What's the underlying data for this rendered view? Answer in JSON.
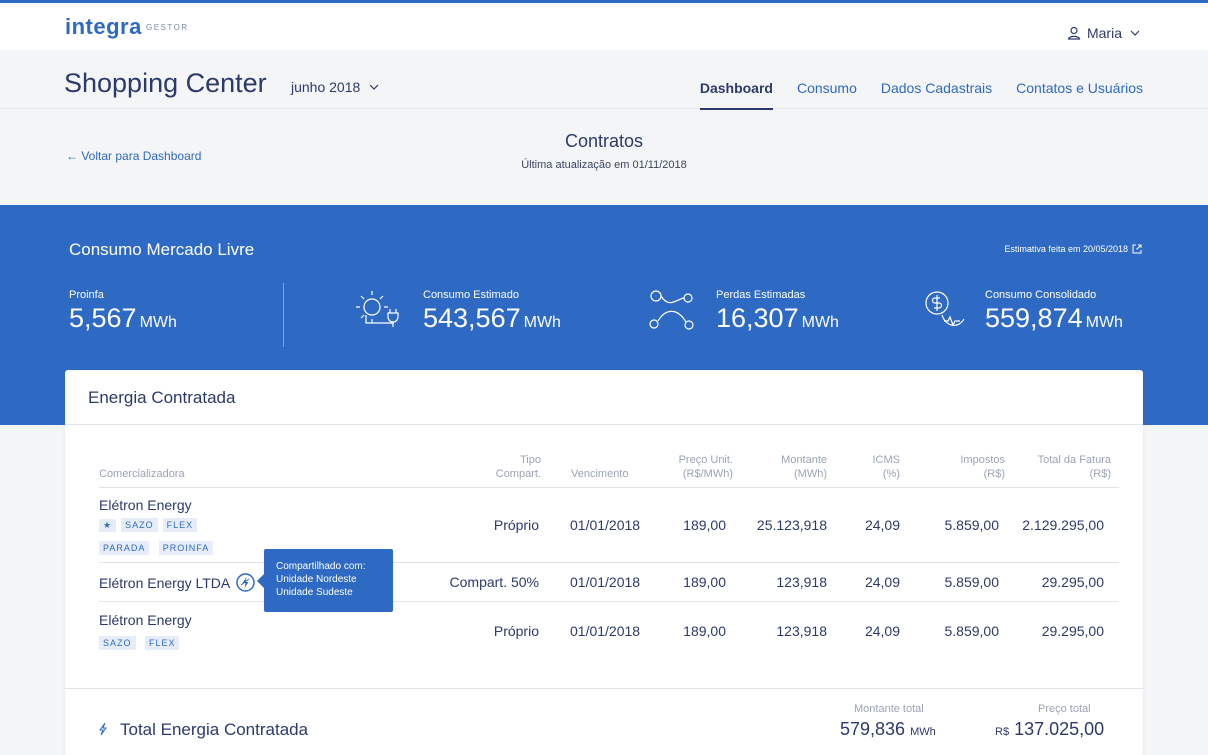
{
  "header": {
    "logo": "integra",
    "logo_sub": "GESTOR",
    "user_name": "Maria"
  },
  "subheader": {
    "title": "Shopping Center",
    "period": "junho 2018",
    "tabs": [
      {
        "label": "Dashboard",
        "active": true
      },
      {
        "label": "Consumo",
        "active": false
      },
      {
        "label": "Dados Cadastrais",
        "active": false
      },
      {
        "label": "Contatos e Usuários",
        "active": false
      }
    ]
  },
  "page": {
    "back_link": "← Voltar para Dashboard",
    "title": "Contratos",
    "updated": "Última atualização em 01/11/2018"
  },
  "mercado": {
    "title": "Consumo Mercado Livre",
    "note": "Estimativa feita em 20/05/2018",
    "metrics": [
      {
        "label": "Proinfa",
        "value": "5,567",
        "unit": "MWh",
        "icon": "none"
      },
      {
        "label": "Consumo Estimado",
        "value": "543,567",
        "unit": "MWh",
        "icon": "sun-plug-icon"
      },
      {
        "label": "Perdas Estimadas",
        "value": "16,307",
        "unit": "MWh",
        "icon": "network-icon"
      },
      {
        "label": "Consumo Consolidado",
        "value": "559,874",
        "unit": "MWh",
        "icon": "money-pulse-icon"
      }
    ]
  },
  "energia": {
    "title": "Energia Contratada",
    "columns": {
      "comercializadora": "Comercializadora",
      "tipo_1": "Tipo",
      "tipo_2": "Compart.",
      "vencimento": "Vencimento",
      "preco_1": "Preço Unit.",
      "preco_2": "(R$/MWh)",
      "montante_1": "Montante",
      "montante_2": "(MWh)",
      "icms_1": "ICMS",
      "icms_2": "(%)",
      "impostos_1": "Impostos",
      "impostos_2": "(R$)",
      "total_1": "Total da Fatura",
      "total_2": "(R$)"
    },
    "rows": [
      {
        "name": "Elétron Energy",
        "tags1": [
          "SAZO",
          "FLEX"
        ],
        "tags2": [
          "PARADA",
          "PROINFA"
        ],
        "tipo": "Próprio",
        "vencimento": "01/01/2018",
        "preco": "189,00",
        "montante": "25.123,918",
        "icms": "24,09",
        "impostos": "5.859,00",
        "total": "2.129.295,00"
      },
      {
        "name": "Elétron Energy LTDA",
        "tipo": "Compart. 50%",
        "vencimento": "01/01/2018",
        "preco": "189,00",
        "montante": "123,918",
        "icms": "24,09",
        "impostos": "5.859,00",
        "total": "29.295,00"
      },
      {
        "name": "Elétron Energy",
        "tags1": [
          "SAZO",
          "FLEX"
        ],
        "tipo": "Próprio",
        "vencimento": "01/01/2018",
        "preco": "189,00",
        "montante": "123,918",
        "icms": "24,09",
        "impostos": "5.859,00",
        "total": "29.295,00"
      }
    ],
    "tooltip": {
      "line1": "Compartilhado com:",
      "line2": "Unidade Nordeste",
      "line3": "Unidade Sudeste"
    },
    "total": {
      "title": "Total Energia Contratada",
      "montante_label": "Montante total",
      "montante_value": "579,836",
      "montante_unit": "MWh",
      "preco_label": "Preço total",
      "preco_currency": "R$",
      "preco_value": "137.025,00"
    }
  },
  "colors": {
    "accent": "#2e6ac3",
    "text": "#2c3a6b"
  }
}
